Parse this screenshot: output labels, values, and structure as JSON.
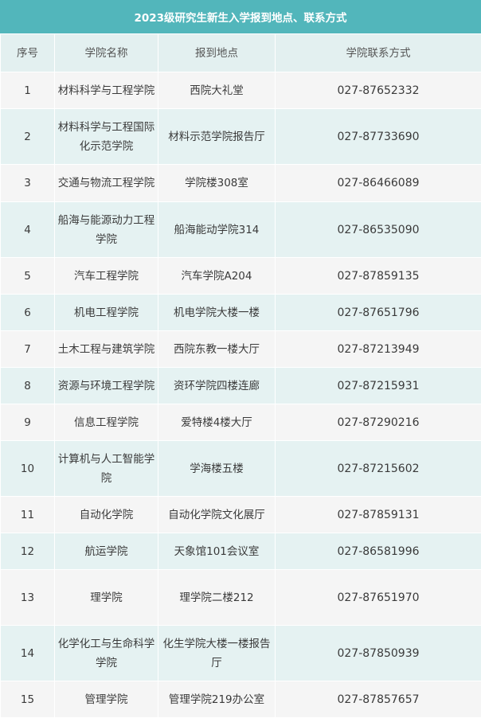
{
  "title": "2023级研究生新生入学报到地点、联系方式",
  "headers": [
    "序号",
    "学院名称",
    "报到地点",
    "学院联系方式"
  ],
  "rows": [
    {
      "no": "1",
      "college": "材料科学与工程学院",
      "location": "西院大礼堂",
      "phone": "027-87652332"
    },
    {
      "no": "2",
      "college": "材料科学与工程国际化示范学院",
      "location": "材料示范学院报告厅",
      "phone": "027-87733690"
    },
    {
      "no": "3",
      "college": "交通与物流工程学院",
      "location": "学院楼308室",
      "phone": "027-86466089"
    },
    {
      "no": "4",
      "college": "船海与能源动力工程学院",
      "location": "船海能动学院314",
      "phone": "027-86535090"
    },
    {
      "no": "5",
      "college": "汽车工程学院",
      "location": "汽车学院A204",
      "phone": "027-87859135"
    },
    {
      "no": "6",
      "college": "机电工程学院",
      "location": "机电学院大楼一楼",
      "phone": "027-87651796"
    },
    {
      "no": "7",
      "college": "土木工程与建筑学院",
      "location": "西院东教一楼大厅",
      "phone": "027-87213949"
    },
    {
      "no": "8",
      "college": "资源与环境工程学院",
      "location": "资环学院四楼连廊",
      "phone": "027-87215931"
    },
    {
      "no": "9",
      "college": "信息工程学院",
      "location": "爱特楼4楼大厅",
      "phone": "027-87290216"
    },
    {
      "no": "10",
      "college": "计算机与人工智能学院",
      "location": "学海楼五楼",
      "phone": "027-87215602"
    },
    {
      "no": "11",
      "college": "自动化学院",
      "location": "自动化学院文化展厅",
      "phone": "027-87859131"
    },
    {
      "no": "12",
      "college": "航运学院",
      "location": "天象馆101会议室",
      "phone": "027-86581996"
    },
    {
      "no": "13",
      "college": "理学院",
      "location": "理学院二楼212",
      "phone": "027-87651970"
    },
    {
      "no": "14",
      "college": "化学化工与生命科学学院",
      "location": "化生学院大楼一楼报告厅",
      "phone": "027-87850939"
    },
    {
      "no": "15",
      "college": "管理学院",
      "location": "管理学院219办公室",
      "phone": "027-87857657"
    }
  ],
  "colors": {
    "title_bg": "#52b6bb",
    "row_odd": "#f5f5f5",
    "row_even": "#e5f2f2",
    "header_bg": "#e3f0f0"
  }
}
